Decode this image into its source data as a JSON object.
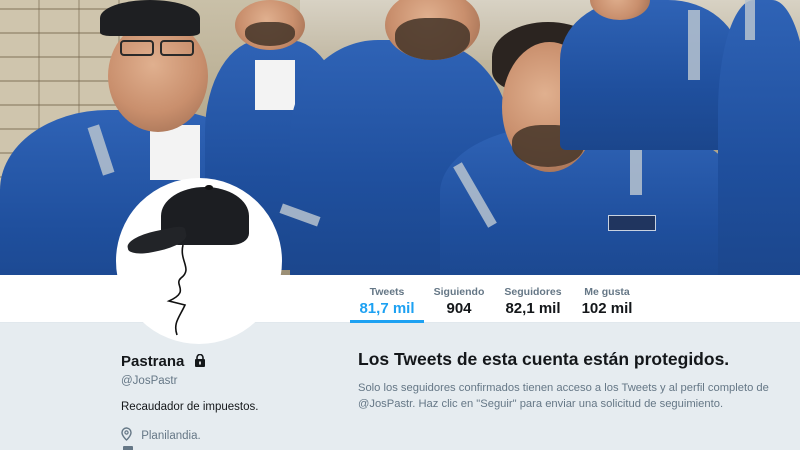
{
  "profile": {
    "name": "Pastrana",
    "handle": "@JosPastr",
    "bio": "Recaudador de impuestos.",
    "location": "Planilandia.",
    "icons": {
      "lock": "lock-icon",
      "location": "location-pin-icon",
      "avatar": "cap-avatar"
    }
  },
  "nav": {
    "stats": [
      {
        "label": "Tweets",
        "value": "81,7 mil",
        "active": true
      },
      {
        "label": "Siguiendo",
        "value": "904",
        "active": false
      },
      {
        "label": "Seguidores",
        "value": "82,1 mil",
        "active": false
      },
      {
        "label": "Me gusta",
        "value": "102 mil",
        "active": false
      }
    ]
  },
  "protected": {
    "title": "Los Tweets de esta cuenta están protegidos.",
    "text": "Solo los seguidores confirmados tienen acceso a los Tweets y al perfil completo de @JosPastr. Haz clic en \"Seguir\" para enviar una solicitud de seguimiento."
  },
  "colors": {
    "accent": "#1da1f2",
    "background": "#e6ecf0",
    "text": "#14171a",
    "muted": "#657786"
  }
}
